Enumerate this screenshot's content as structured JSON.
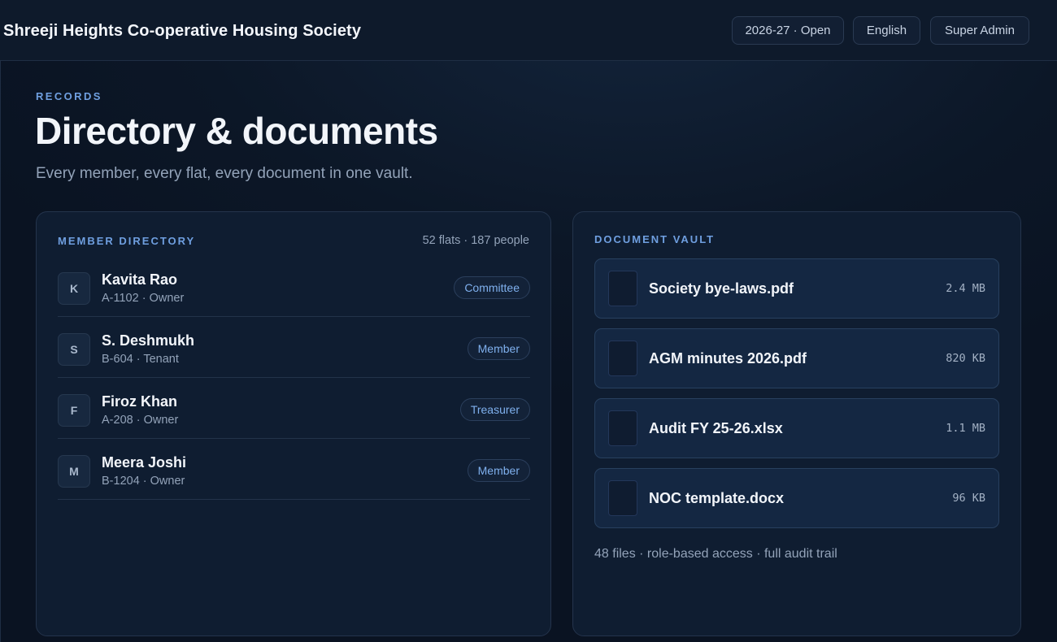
{
  "header": {
    "society_name": "Shreeji Heights Co-operative Housing Society",
    "year_label": "2026-27 · Open",
    "language_label": "English",
    "role_label": "Super Admin"
  },
  "page": {
    "eyebrow": "RECORDS",
    "title": "Directory & documents",
    "subtitle": "Every member, every flat, every document in one vault."
  },
  "members": {
    "heading": "MEMBER DIRECTORY",
    "count": "52 flats · 187 people",
    "items": [
      {
        "initial": "K",
        "name": "Kavita Rao",
        "detail": "A-1102 · Owner",
        "role": "Committee"
      },
      {
        "initial": "S",
        "name": "S. Deshmukh",
        "detail": "B-604 · Tenant",
        "role": "Member"
      },
      {
        "initial": "F",
        "name": "Firoz Khan",
        "detail": "A-208 · Owner",
        "role": "Treasurer"
      },
      {
        "initial": "M",
        "name": "Meera Joshi",
        "detail": "B-1204 · Owner",
        "role": "Member"
      }
    ]
  },
  "vault": {
    "heading": "DOCUMENT VAULT",
    "items": [
      {
        "name": "Society bye-laws.pdf",
        "size": "2.4 MB"
      },
      {
        "name": "AGM minutes 2026.pdf",
        "size": "820 KB"
      },
      {
        "name": "Audit FY 25-26.xlsx",
        "size": "1.1 MB"
      },
      {
        "name": "NOC template.docx",
        "size": "96 KB"
      }
    ],
    "footer": "48 files · role-based access · full audit trail"
  },
  "colors": {
    "accent": "#6f9fe0",
    "background": "#0c1626",
    "card": "#0f1d31"
  }
}
